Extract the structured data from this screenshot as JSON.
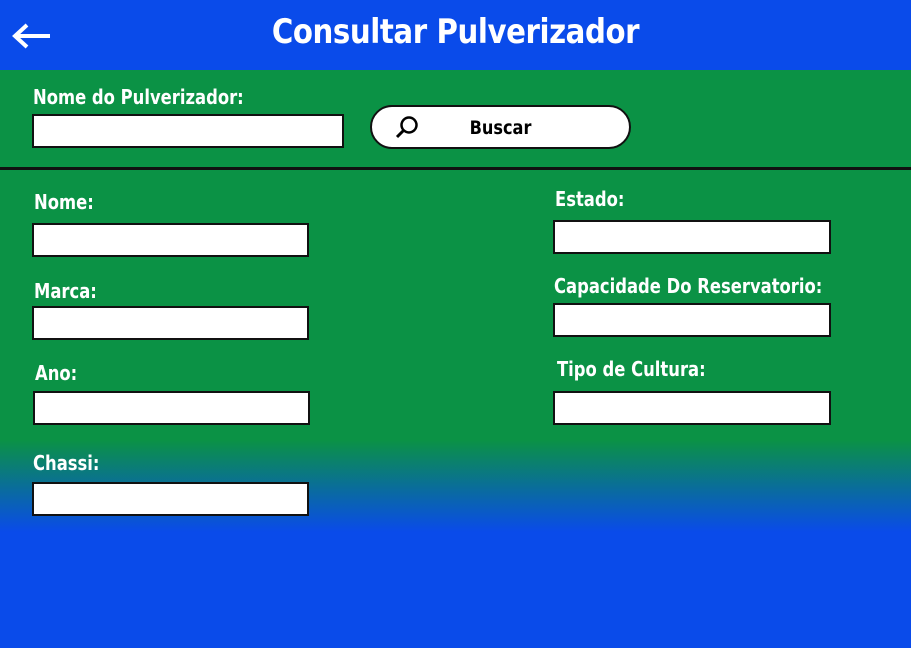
{
  "header": {
    "title": "Consultar Pulverizador",
    "back_icon": "arrow-left-icon"
  },
  "search": {
    "label": "Nome do Pulverizador:",
    "value": "",
    "button_label": "Buscar",
    "button_icon": "search-icon"
  },
  "form": {
    "nome": {
      "label": "Nome:",
      "value": ""
    },
    "marca": {
      "label": "Marca:",
      "value": ""
    },
    "ano": {
      "label": "Ano:",
      "value": ""
    },
    "chassi": {
      "label": "Chassi:",
      "value": ""
    },
    "estado": {
      "label": "Estado:",
      "value": ""
    },
    "capacidade": {
      "label": "Capacidade Do Reservatorio:",
      "value": ""
    },
    "tipo_cultura": {
      "label": "Tipo de Cultura:",
      "value": ""
    }
  },
  "colors": {
    "blue": "#0a4bea",
    "green": "#0b9245",
    "text": "#ffffff"
  }
}
